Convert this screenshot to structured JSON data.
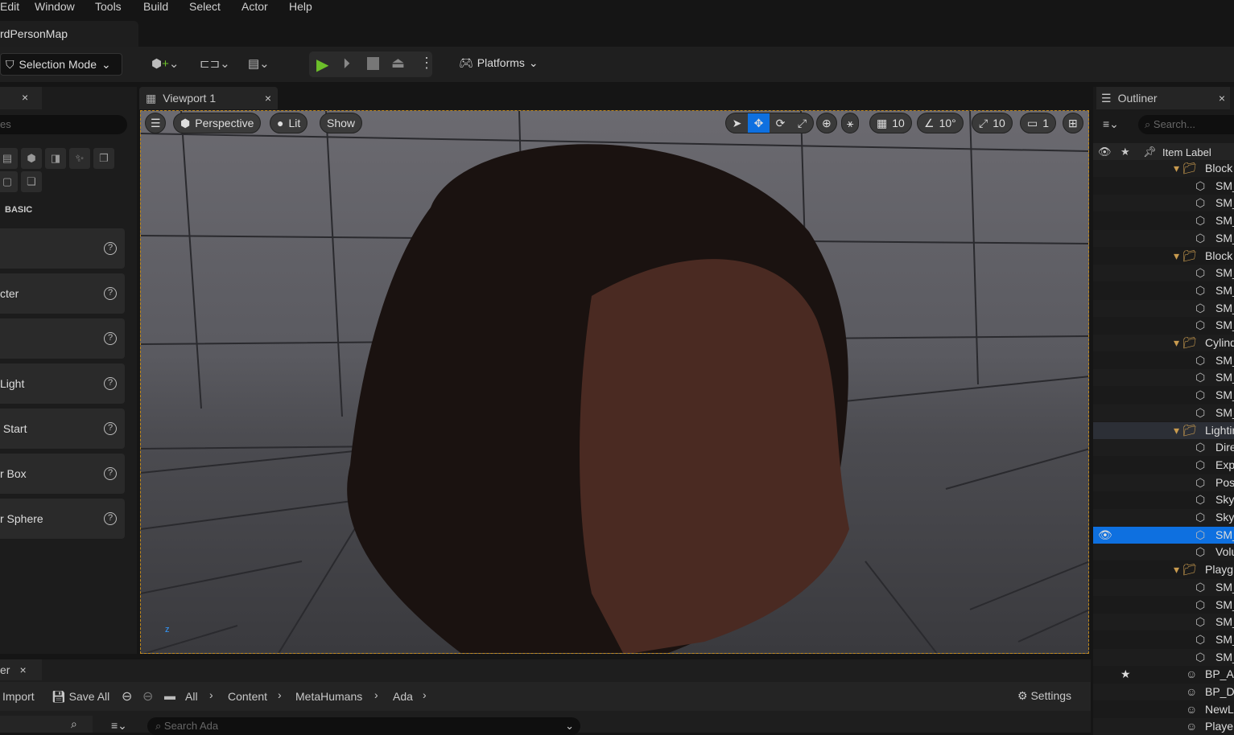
{
  "menu": [
    "Edit",
    "Window",
    "Tools",
    "Build",
    "Select",
    "Actor",
    "Help"
  ],
  "map_tab": "rdPersonMap",
  "toolbar": {
    "selection_mode": "Selection Mode",
    "platforms": "Platforms"
  },
  "left_panel": {
    "search_placeholder": "es",
    "section": "BASIC",
    "items": [
      "",
      "cter",
      "",
      "Light",
      " Start",
      "r Box",
      "r Sphere"
    ],
    "help": "?"
  },
  "viewport": {
    "tab": "Viewport 1",
    "perspective": "Perspective",
    "lit": "Lit",
    "show": "Show",
    "grid_snap": "10",
    "rot_snap": "10°",
    "scale_snap": "10",
    "camera_speed": "1"
  },
  "outliner": {
    "title": "Outliner",
    "search_placeholder": "Search...",
    "column": "Item Label",
    "rows": [
      {
        "t": "f",
        "label": "Block"
      },
      {
        "t": "m",
        "label": "SM_"
      },
      {
        "t": "m",
        "label": "SM_"
      },
      {
        "t": "m",
        "label": "SM_"
      },
      {
        "t": "m",
        "label": "SM_"
      },
      {
        "t": "f",
        "label": "Block"
      },
      {
        "t": "m",
        "label": "SM_"
      },
      {
        "t": "m",
        "label": "SM_"
      },
      {
        "t": "m",
        "label": "SM_"
      },
      {
        "t": "m",
        "label": "SM_"
      },
      {
        "t": "f",
        "label": "Cylind"
      },
      {
        "t": "m",
        "label": "SM_"
      },
      {
        "t": "m",
        "label": "SM_"
      },
      {
        "t": "m",
        "label": "SM_"
      },
      {
        "t": "m",
        "label": "SM_"
      },
      {
        "t": "f",
        "label": "Lightin"
      },
      {
        "t": "m",
        "label": "Dire"
      },
      {
        "t": "m",
        "label": "Exp"
      },
      {
        "t": "m",
        "label": "Pos"
      },
      {
        "t": "m",
        "label": "Sky"
      },
      {
        "t": "m",
        "label": "Sky"
      },
      {
        "t": "s",
        "label": "SM_"
      },
      {
        "t": "m",
        "label": "Volu"
      },
      {
        "t": "f",
        "label": "Playg"
      },
      {
        "t": "m",
        "label": "SM_"
      },
      {
        "t": "m",
        "label": "SM_"
      },
      {
        "t": "m",
        "label": "SM_"
      },
      {
        "t": "m",
        "label": "SM_"
      },
      {
        "t": "m",
        "label": "SM_"
      },
      {
        "t": "r",
        "label": "BP_Ac"
      },
      {
        "t": "r",
        "label": "BP_D"
      },
      {
        "t": "r",
        "label": "NewL"
      },
      {
        "t": "r",
        "label": "Playe"
      }
    ]
  },
  "content_browser": {
    "tab": "er",
    "import": "Import",
    "save_all": "Save All",
    "breadcrumb": [
      "All",
      "Content",
      "MetaHumans",
      "Ada"
    ],
    "settings": "Settings",
    "search_placeholder": "Search Ada"
  },
  "colors": {
    "accent": "#0e70e0",
    "play": "#6cbf2a",
    "selection_border": "#c28a1c"
  }
}
